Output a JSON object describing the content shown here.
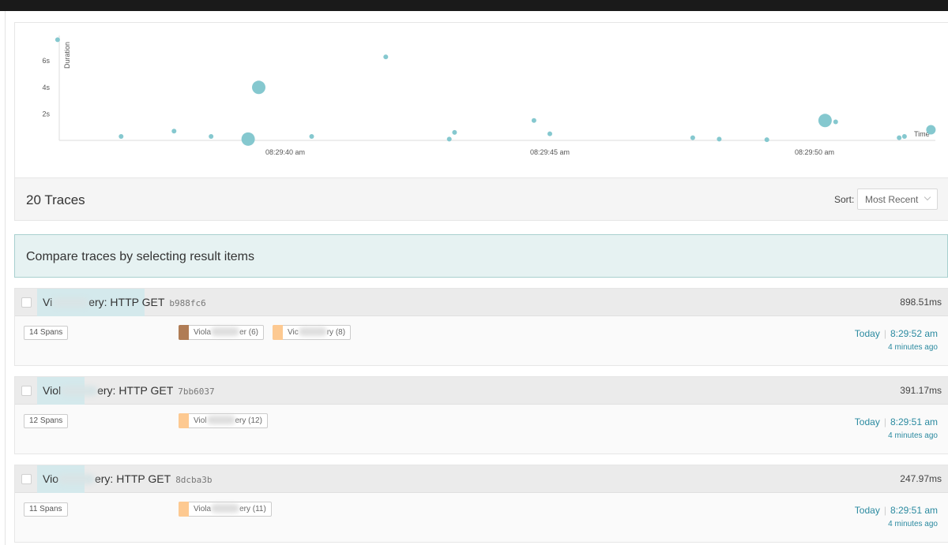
{
  "plot": {
    "y_axis_label": "Duration",
    "x_axis_label": "Time",
    "y_ticks": [
      "6s",
      "4s",
      "2s"
    ],
    "x_ticks": [
      "08:29:40 am",
      "08:29:45 am",
      "08:29:50 am"
    ],
    "point_color": "#7ec5cc"
  },
  "chart_data": {
    "type": "scatter",
    "title": "",
    "xlabel": "Time",
    "ylabel": "Duration",
    "ylim": [
      0,
      8
    ],
    "xlim": [
      "08:29:35.7",
      "08:29:52.2"
    ],
    "points": [
      {
        "x": "08:29:35.7",
        "y": 7.6,
        "size": "small"
      },
      {
        "x": "08:29:36.9",
        "y": 0.3,
        "size": "small"
      },
      {
        "x": "08:29:37.9",
        "y": 0.7,
        "size": "small"
      },
      {
        "x": "08:29:38.6",
        "y": 0.3,
        "size": "small"
      },
      {
        "x": "08:29:39.3",
        "y": 0.1,
        "size": "large"
      },
      {
        "x": "08:29:39.5",
        "y": 4.0,
        "size": "large"
      },
      {
        "x": "08:29:40.5",
        "y": 0.3,
        "size": "small"
      },
      {
        "x": "08:29:41.9",
        "y": 6.3,
        "size": "small"
      },
      {
        "x": "08:29:43.1",
        "y": 0.1,
        "size": "small"
      },
      {
        "x": "08:29:43.2",
        "y": 0.6,
        "size": "small"
      },
      {
        "x": "08:29:44.7",
        "y": 1.5,
        "size": "small"
      },
      {
        "x": "08:29:45.0",
        "y": 0.5,
        "size": "small"
      },
      {
        "x": "08:29:47.7",
        "y": 0.2,
        "size": "small"
      },
      {
        "x": "08:29:48.2",
        "y": 0.1,
        "size": "small"
      },
      {
        "x": "08:29:49.1",
        "y": 0.05,
        "size": "small"
      },
      {
        "x": "08:29:50.2",
        "y": 1.5,
        "size": "large"
      },
      {
        "x": "08:29:50.4",
        "y": 1.4,
        "size": "small"
      },
      {
        "x": "08:29:51.6",
        "y": 0.2,
        "size": "small"
      },
      {
        "x": "08:29:51.7",
        "y": 0.3,
        "size": "small"
      },
      {
        "x": "08:29:52.2",
        "y": 0.8,
        "size": "medium"
      }
    ]
  },
  "traces_header": {
    "count_label": "20 Traces",
    "sort_label": "Sort:",
    "sort_value": "Most Recent"
  },
  "compare_banner": "Compare traces by selecting result items",
  "traces": [
    {
      "name_prefix": "Vi",
      "name_suffix": "ery: HTTP GET",
      "trace_id": "b988fc6",
      "duration": "898.51ms",
      "spans": "14 Spans",
      "services": [
        {
          "prefix": "Viola",
          "suffix": "er (6)",
          "color": "#b07c55"
        },
        {
          "prefix": "Vic",
          "suffix": "ry (8)",
          "color": "#fdc991"
        }
      ],
      "day": "Today",
      "time": "8:29:52 am",
      "ago": "4 minutes ago"
    },
    {
      "name_prefix": "Viol",
      "name_suffix": "ery: HTTP GET",
      "trace_id": "7bb6037",
      "duration": "391.17ms",
      "spans": "12 Spans",
      "services": [
        {
          "prefix": "Viol",
          "suffix": "ery (12)",
          "color": "#fdc991"
        }
      ],
      "day": "Today",
      "time": "8:29:51 am",
      "ago": "4 minutes ago"
    },
    {
      "name_prefix": "Vio",
      "name_suffix": "ery: HTTP GET",
      "trace_id": "8dcba3b",
      "duration": "247.97ms",
      "spans": "11 Spans",
      "services": [
        {
          "prefix": "Viola",
          "suffix": "ery (11)",
          "color": "#fdc991"
        }
      ],
      "day": "Today",
      "time": "8:29:51 am",
      "ago": "4 minutes ago"
    }
  ]
}
